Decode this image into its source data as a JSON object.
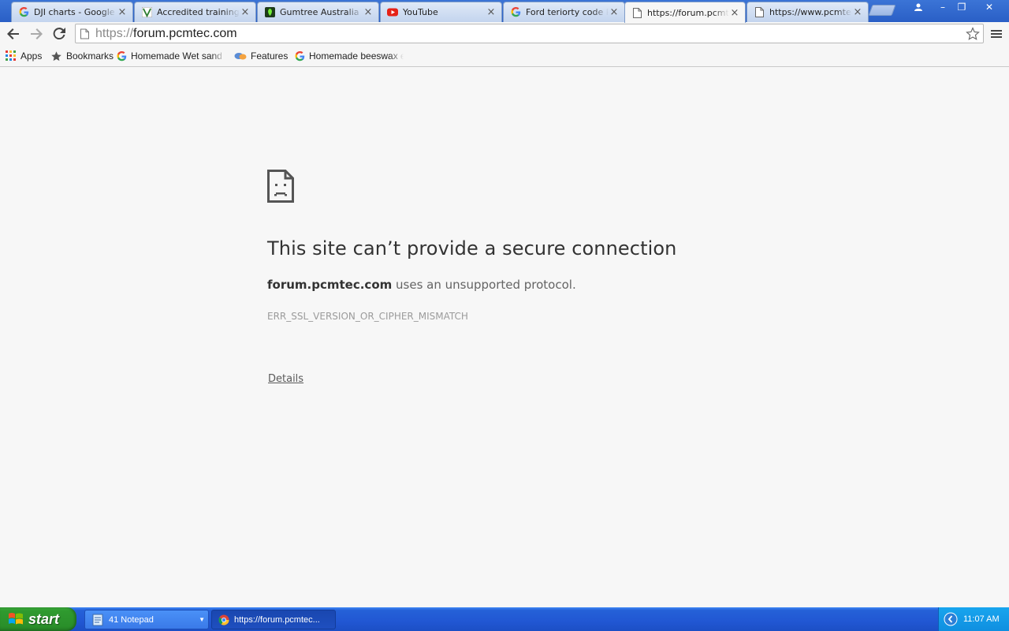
{
  "browser": {
    "tabs": [
      {
        "title": "DJI charts - Google S",
        "icon": "google-g-icon",
        "active": false
      },
      {
        "title": "Accredited training :",
        "icon": "site-v-icon",
        "active": false
      },
      {
        "title": "Gumtree Australia | N",
        "icon": "gumtree-icon",
        "active": false
      },
      {
        "title": "YouTube",
        "icon": "youtube-icon",
        "active": false
      },
      {
        "title": "Ford teriorty code PL",
        "icon": "google-g-icon",
        "active": false
      },
      {
        "title": "https://forum.pcmtec",
        "icon": "page-icon",
        "active": true
      },
      {
        "title": "https://www.pcmtec",
        "icon": "page-icon",
        "active": false
      }
    ],
    "close_glyph": "×",
    "window_controls": {
      "profile": "profile-icon",
      "minimize": "–",
      "maximize": "❐",
      "close": "✕"
    },
    "address": {
      "scheme": "https://",
      "host": "forum.pcmtec.com"
    },
    "bookmarks": [
      {
        "label": "Apps",
        "icon": "apps-grid-icon"
      },
      {
        "label": "Bookmarks",
        "icon": "star-icon"
      },
      {
        "label": "Homemade Wet sand Bla",
        "icon": "google-g-icon"
      },
      {
        "label": "Features",
        "icon": "features-icon"
      },
      {
        "label": "Homemade beeswax em",
        "icon": "google-g-icon"
      }
    ]
  },
  "error": {
    "title": "This site can’t provide a secure connection",
    "domain": "forum.pcmtec.com",
    "description_suffix": " uses an unsupported protocol.",
    "code": "ERR_SSL_VERSION_OR_CIPHER_MISMATCH",
    "details_link": "Details"
  },
  "taskbar": {
    "start_label": "start",
    "tasks": [
      {
        "label": "41 Notepad",
        "icon": "notepad-icon",
        "has_dropdown": true
      },
      {
        "label": "https://forum.pcmtec...",
        "icon": "chrome-icon",
        "has_dropdown": false
      }
    ],
    "clock": "11:07 AM"
  },
  "colors": {
    "tabstrip": "#2a5fc6",
    "taskbar": "#2157d3",
    "start_button": "#2f9a2f",
    "tray": "#0f8fe0",
    "page_bg": "#f7f7f7"
  }
}
